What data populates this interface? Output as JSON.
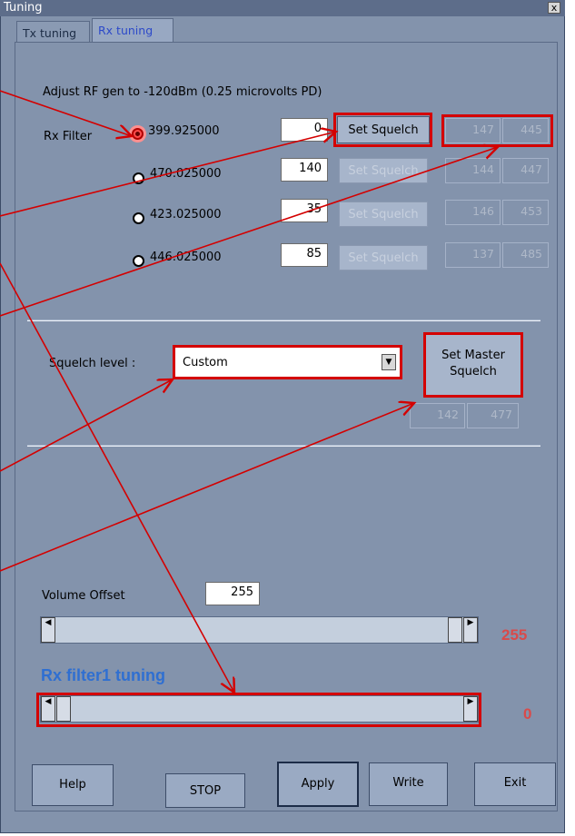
{
  "window": {
    "title": "Tuning",
    "close_glyph": "x"
  },
  "tabs": [
    {
      "label": "Tx tuning"
    },
    {
      "label": "Rx tuning",
      "active": true
    }
  ],
  "instruction": "Adjust RF gen to -120dBm (0.25 microvolts PD)",
  "rx_filter": {
    "label": "Rx Filter",
    "rows": [
      {
        "freq": "399.925000",
        "value": "0",
        "button": "Set Squelch",
        "ro1": "147",
        "ro2": "445",
        "selected": true
      },
      {
        "freq": "470.025000",
        "value": "140",
        "button": "Set Squelch",
        "ro1": "144",
        "ro2": "447"
      },
      {
        "freq": "423.025000",
        "value": "35",
        "button": "Set Squelch",
        "ro1": "146",
        "ro2": "453"
      },
      {
        "freq": "446.025000",
        "value": "85",
        "button": "Set Squelch",
        "ro1": "137",
        "ro2": "485"
      }
    ]
  },
  "squelch": {
    "label": "Squelch level :",
    "selected": "Custom",
    "master_button_line1": "Set Master",
    "master_button_line2": "Squelch",
    "ro1": "142",
    "ro2": "477"
  },
  "volume": {
    "label": "Volume Offset",
    "value": "255",
    "slider_level": 255,
    "readout": "255"
  },
  "rx_tuning": {
    "title": "Rx filter1 tuning",
    "slider_level": 0,
    "readout": "0"
  },
  "buttons": {
    "help": "Help",
    "stop": "STOP",
    "apply": "Apply",
    "write": "Write",
    "exit": "Exit"
  },
  "colors": {
    "window_bg": "#8393ac",
    "highlight_red": "#d40000",
    "readout_red": "#d94a4a",
    "title_blue": "#2f6fd1"
  }
}
